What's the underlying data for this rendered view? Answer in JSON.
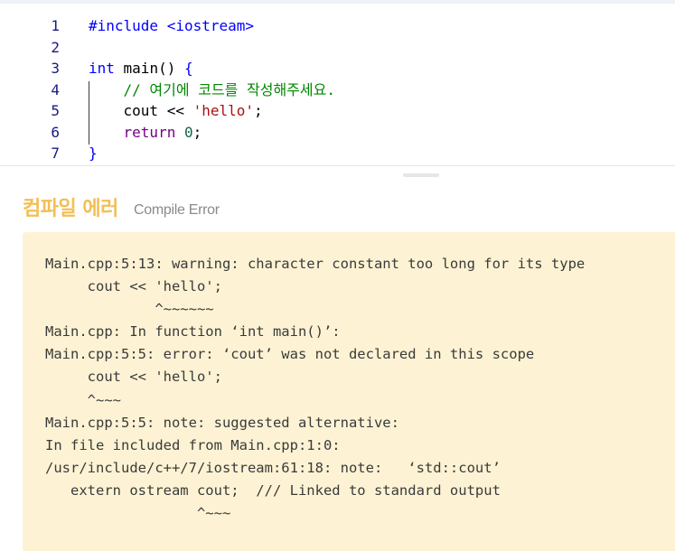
{
  "editor": {
    "lines": [
      {
        "number": "1",
        "tokens": [
          {
            "t": "#include <iostream>",
            "c": "kw"
          }
        ]
      },
      {
        "number": "2",
        "tokens": []
      },
      {
        "number": "3",
        "tokens": [
          {
            "t": "int",
            "c": "kw"
          },
          {
            "t": " main() ",
            "c": ""
          },
          {
            "t": "{",
            "c": "kw"
          }
        ]
      },
      {
        "number": "4",
        "tokens": [
          {
            "t": "    // 여기에 코드를 작성해주세요.",
            "c": "comment"
          }
        ]
      },
      {
        "number": "5",
        "tokens": [
          {
            "t": "    cout << ",
            "c": ""
          },
          {
            "t": "'hello'",
            "c": "str"
          },
          {
            "t": ";",
            "c": ""
          }
        ]
      },
      {
        "number": "6",
        "tokens": [
          {
            "t": "    ",
            "c": ""
          },
          {
            "t": "return",
            "c": "kw-dark"
          },
          {
            "t": " ",
            "c": ""
          },
          {
            "t": "0",
            "c": "num"
          },
          {
            "t": ";",
            "c": ""
          }
        ]
      },
      {
        "number": "7",
        "tokens": [
          {
            "t": "}",
            "c": "kw"
          }
        ]
      }
    ]
  },
  "result": {
    "title": "컴파일 에러",
    "subtitle": "Compile Error",
    "message": "Main.cpp:5:13: warning: character constant too long for its type\n     cout << 'hello';\n             ^~~~~~~\nMain.cpp: In function ‘int main()’:\nMain.cpp:5:5: error: ‘cout’ was not declared in this scope\n     cout << 'hello';\n     ^~~~\nMain.cpp:5:5: note: suggested alternative:\nIn file included from Main.cpp:1:0:\n/usr/include/c++/7/iostream:61:18: note:   ‘std::cout’\n   extern ostream cout;  /// Linked to standard output\n                  ^~~~"
  },
  "colors": {
    "title": "#f2bf55",
    "error_background": "#fdf3d4"
  }
}
